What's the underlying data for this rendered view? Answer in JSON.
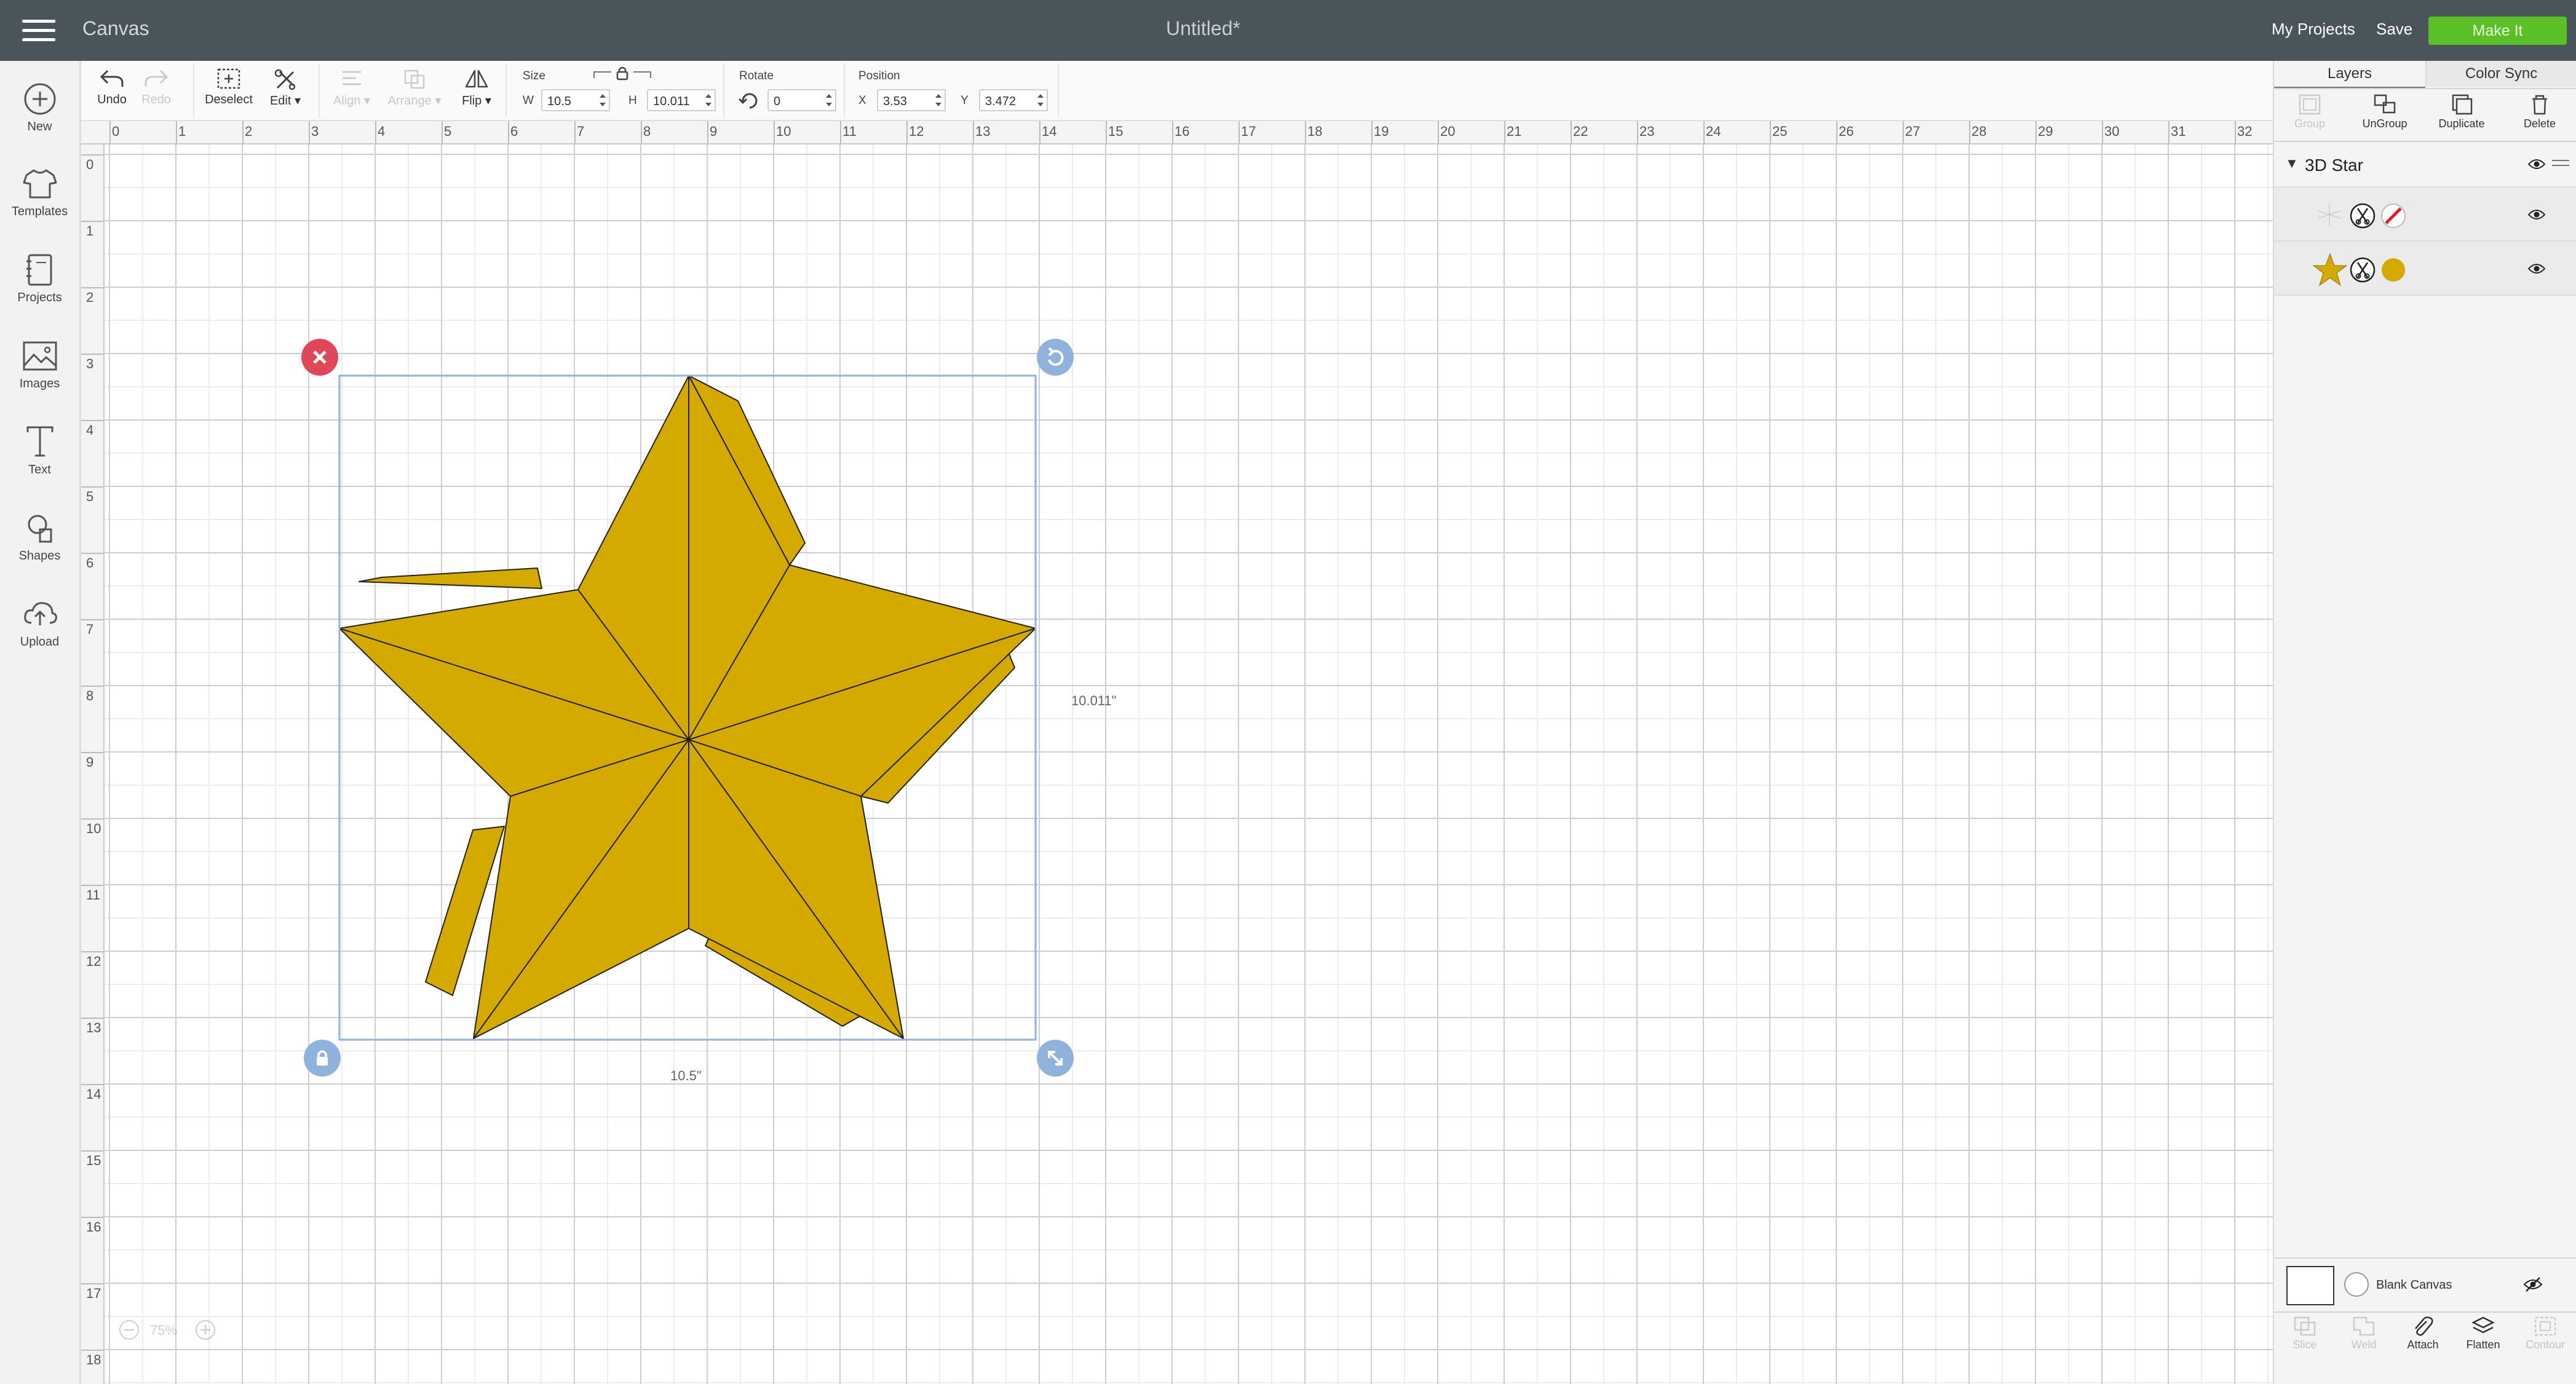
{
  "header": {
    "app_title": "Canvas",
    "doc_title": "Untitled*",
    "my_projects": "My Projects",
    "save": "Save",
    "make_it": "Make It"
  },
  "sidebar": {
    "items": [
      {
        "label": "New",
        "icon": "plus-circle-icon"
      },
      {
        "label": "Templates",
        "icon": "tshirt-icon"
      },
      {
        "label": "Projects",
        "icon": "notebook-icon"
      },
      {
        "label": "Images",
        "icon": "image-icon"
      },
      {
        "label": "Text",
        "icon": "text-t-icon"
      },
      {
        "label": "Shapes",
        "icon": "shapes-icon"
      },
      {
        "label": "Upload",
        "icon": "cloud-upload-icon"
      }
    ]
  },
  "toolbar": {
    "undo": "Undo",
    "redo": "Redo",
    "deselect": "Deselect",
    "edit": "Edit",
    "align": "Align",
    "arrange": "Arrange",
    "flip": "Flip",
    "size_label": "Size",
    "w_label": "W",
    "w_value": "10.5",
    "h_label": "H",
    "h_value": "10.011",
    "rotate_label": "Rotate",
    "rotate_value": "0",
    "position_label": "Position",
    "x_label": "X",
    "x_value": "3.53",
    "y_label": "Y",
    "y_value": "3.472"
  },
  "ruler": {
    "h_ticks": [
      "0",
      "1",
      "2",
      "3",
      "4",
      "5",
      "6",
      "7",
      "8",
      "9",
      "10",
      "11",
      "12",
      "13",
      "14",
      "15",
      "16",
      "17",
      "18",
      "19",
      "20",
      "21",
      "22",
      "23",
      "24",
      "25",
      "26",
      "27",
      "28",
      "29",
      "30",
      "31",
      "32"
    ],
    "v_ticks": [
      "0",
      "1",
      "2",
      "3",
      "4",
      "5",
      "6",
      "7",
      "8",
      "9",
      "10",
      "11",
      "12",
      "13",
      "14",
      "15",
      "16",
      "17",
      "18"
    ]
  },
  "canvas": {
    "width_label": "10.5\"",
    "height_label": "10.011\"",
    "zoom": "75%",
    "star_color": "#d4aa00",
    "selection_color": "#8fb3dc"
  },
  "right_panel": {
    "tabs": [
      "Layers",
      "Color Sync"
    ],
    "actions": [
      "Group",
      "UnGroup",
      "Duplicate",
      "Delete"
    ],
    "group_name": "3D Star",
    "layer_colors": [
      "#e02020",
      "#d4aa00"
    ],
    "blank_canvas": "Blank Canvas",
    "bottom_actions": [
      "Slice",
      "Weld",
      "Attach",
      "Flatten",
      "Contour"
    ]
  },
  "colors": {
    "header_bg": "#4a545b",
    "make_it_green": "#5bbf28",
    "delete_handle_red": "#e0485a",
    "handle_blue": "#8fb3dc"
  }
}
